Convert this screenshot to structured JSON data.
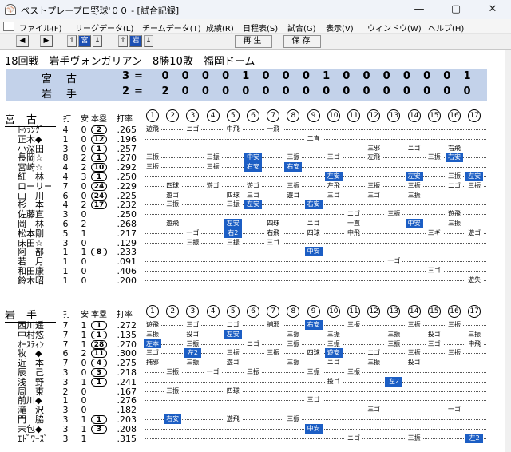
{
  "window": {
    "title": "ベストプレープロ野球'００ - [試合記録]",
    "app_icon": "baseball-icon"
  },
  "menu": [
    "ファイル(F)",
    "リーグデータ(L)",
    "チームデータ(T)",
    "成績(R)",
    "日程表(S)",
    "試合(G)",
    "表示(V)",
    "ウィンドウ(W)",
    "ヘルプ(H)"
  ],
  "toolbar": {
    "prev": "◀",
    "next": "▶",
    "up1": "↑",
    "team1": "宮",
    "down1": "↓",
    "up2": "↑",
    "team2": "岩",
    "down2": "↓",
    "play": "再生",
    "save": "保存"
  },
  "game_info": "18回戦　岩手ヴォンガリアン　8勝10敗　福岡ドーム",
  "scoreboard": {
    "rows": [
      {
        "team": "宮古",
        "total": "3",
        "eq": "=",
        "innings": [
          "0",
          "0",
          "0",
          "0",
          "1",
          "0",
          "0",
          "0",
          "1",
          "0",
          "0",
          "0",
          "0",
          "0",
          "0",
          "1"
        ]
      },
      {
        "team": "岩手",
        "total": "2",
        "eq": "=",
        "innings": [
          "2",
          "0",
          "0",
          "0",
          "0",
          "0",
          "0",
          "0",
          "0",
          "0",
          "0",
          "0",
          "0",
          "0",
          "0",
          "0"
        ]
      }
    ]
  },
  "columns": {
    "ab": "打",
    "hits": "安",
    "hr": "本塁",
    "avg": "打率"
  },
  "inning_numbers": [
    "1",
    "2",
    "3",
    "4",
    "5",
    "6",
    "7",
    "8",
    "9",
    "10",
    "11",
    "12",
    "13",
    "14",
    "15",
    "16",
    "17"
  ],
  "teams": [
    {
      "name": "宮古",
      "players": [
        {
          "name": "ﾄｩﾗﾝｸﾞ",
          "ab": "4",
          "h": "0",
          "hr": "2",
          "avg": ".265",
          "r": [
            "遊飛",
            "",
            "ニゴ",
            "",
            "中飛",
            "",
            "一飛",
            "",
            "",
            "",
            "",
            "",
            "",
            "",
            "",
            "",
            ""
          ]
        },
        {
          "name": "正木◆",
          "ab": "1",
          "h": "0",
          "hr": "12",
          "avg": ".196",
          "r": [
            "",
            "",
            "",
            "",
            "",
            "",
            "",
            "",
            "二直",
            "",
            "",
            "",
            "",
            "",
            "",
            "",
            ""
          ]
        },
        {
          "name": "小深田",
          "ab": "3",
          "h": "0",
          "hr": "1",
          "avg": ".257",
          "r": [
            "",
            "",
            "",
            "",
            "",
            "",
            "",
            "",
            "",
            "",
            "",
            "三邪",
            "",
            "ニゴ",
            "",
            "右飛",
            ""
          ]
        },
        {
          "name": "長岡☆",
          "ab": "8",
          "h": "2",
          "hr": "1",
          "avg": ".270",
          "r": [
            "三振",
            "",
            "",
            "三振",
            "",
            "中安",
            "",
            "三振",
            "",
            "三ゴ",
            "",
            "左飛",
            "",
            "",
            "三振",
            "右安",
            ""
          ]
        },
        {
          "name": "宮崎☆",
          "ab": "4",
          "h": "2",
          "hr": "10",
          "avg": ".292",
          "r": [
            "三振",
            "",
            "",
            "三振",
            "",
            "右安",
            "",
            "右安",
            "",
            "",
            "",
            "",
            "",
            "",
            "",
            "",
            ""
          ]
        },
        {
          "name": "紅　林",
          "ab": "4",
          "h": "3",
          "hr": "1",
          "avg": ".250",
          "r": [
            "",
            "",
            "",
            "",
            "",
            "",
            "",
            "",
            "",
            "左安",
            "",
            "",
            "",
            "左安",
            "",
            "三振",
            "左安"
          ]
        },
        {
          "name": "ローリー",
          "ab": "7",
          "h": "0",
          "hr": "24",
          "avg": ".229",
          "r": [
            "",
            "四球",
            "",
            "遊ゴ",
            "",
            "遊ゴ",
            "",
            "三振",
            "",
            "左飛",
            "",
            "三振",
            "",
            "三振",
            "",
            "ニゴ",
            "三振"
          ]
        },
        {
          "name": "山　川",
          "ab": "6",
          "h": "0",
          "hr": "24",
          "avg": ".225",
          "r": [
            "",
            "遊ゴ",
            "",
            "",
            "四球",
            "三ゴ",
            "",
            "遊ゴ",
            "",
            "三ゴ",
            "",
            "三ゴ",
            "",
            "三振",
            "",
            "",
            ""
          ]
        },
        {
          "name": "杉　本",
          "ab": "4",
          "h": "2",
          "hr": "17",
          "avg": ".232",
          "r": [
            "",
            "三振",
            "",
            "",
            "三振",
            "左安",
            "",
            "",
            "右安",
            "",
            "",
            "",
            "",
            "",
            "",
            "",
            ""
          ]
        },
        {
          "name": "佐藤直",
          "ab": "3",
          "h": "0",
          "hr": "",
          "avg": ".250",
          "r": [
            "",
            "",
            "",
            "",
            "",
            "",
            "",
            "",
            "",
            "",
            "ニゴ",
            "",
            "三振",
            "",
            "",
            "遊飛",
            ""
          ]
        },
        {
          "name": "岡　林",
          "ab": "6",
          "h": "2",
          "hr": "",
          "avg": ".268",
          "r": [
            "",
            "遊飛",
            "",
            "",
            "左安",
            "",
            "四球",
            "",
            "ニゴ",
            "",
            "一直",
            "",
            "",
            "中安",
            "",
            "三振",
            ""
          ]
        },
        {
          "name": "松本剛",
          "ab": "5",
          "h": "1",
          "hr": "",
          "avg": ".217",
          "r": [
            "",
            "",
            "一ゴ",
            "",
            "右2",
            "",
            "右飛",
            "",
            "四球",
            "",
            "中飛",
            "",
            "",
            "",
            "三ギ",
            "",
            "遊ゴ"
          ]
        },
        {
          "name": "床田☆",
          "ab": "3",
          "h": "0",
          "hr": "",
          "avg": ".129",
          "r": [
            "",
            "",
            "三振",
            "",
            "三振",
            "",
            "三ゴ",
            "",
            "",
            "",
            "",
            "",
            "",
            "",
            "",
            "",
            ""
          ]
        },
        {
          "name": "阿　部",
          "ab": "1",
          "h": "1",
          "hr": "8",
          "avg": ".233",
          "r": [
            "",
            "",
            "",
            "",
            "",
            "",
            "",
            "",
            "中安",
            "",
            "",
            "",
            "",
            "",
            "",
            "",
            ""
          ]
        },
        {
          "name": "若　月",
          "ab": "1",
          "h": "0",
          "hr": "",
          "avg": ".091",
          "r": [
            "",
            "",
            "",
            "",
            "",
            "",
            "",
            "",
            "",
            "",
            "",
            "",
            "一ゴ",
            "",
            "",
            "",
            ""
          ]
        },
        {
          "name": "和田康",
          "ab": "1",
          "h": "0",
          "hr": "",
          "avg": ".406",
          "r": [
            "",
            "",
            "",
            "",
            "",
            "",
            "",
            "",
            "",
            "",
            "",
            "",
            "",
            "",
            "三ゴ",
            "",
            ""
          ]
        },
        {
          "name": "鈴木昭",
          "ab": "1",
          "h": "0",
          "hr": "",
          "avg": ".200",
          "r": [
            "",
            "",
            "",
            "",
            "",
            "",
            "",
            "",
            "",
            "",
            "",
            "",
            "",
            "",
            "",
            "",
            "遊失"
          ]
        }
      ]
    },
    {
      "name": "岩手",
      "players": [
        {
          "name": "西川遥",
          "ab": "7",
          "h": "1",
          "hr": "1",
          "avg": ".272",
          "r": [
            "遊飛",
            "",
            "三ゴ",
            "",
            "ニゴ",
            "",
            "捕邪",
            "",
            "右安",
            "",
            "三振",
            "",
            "",
            "三振",
            "",
            "三振",
            ""
          ]
        },
        {
          "name": "中村悠",
          "ab": "7",
          "h": "1",
          "hr": "1",
          "avg": ".135",
          "r": [
            "三振",
            "",
            "投ゴ",
            "",
            "左安",
            "",
            "",
            "三振",
            "",
            "三振",
            "",
            "",
            "三振",
            "",
            "投ゴ",
            "",
            "三振"
          ]
        },
        {
          "name": "ｵｰｽﾃｨﾝ",
          "ab": "7",
          "h": "1",
          "hr": "28",
          "avg": ".270",
          "r": [
            "左本",
            "",
            "三振",
            "",
            "",
            "ニゴ",
            "",
            "三振",
            "",
            "三振",
            "",
            "",
            "三振",
            "",
            "三ゴ",
            "",
            "中飛"
          ]
        },
        {
          "name": "牧　◆",
          "ab": "6",
          "h": "2",
          "hr": "11",
          "avg": ".300",
          "r": [
            "三ゴ",
            "",
            "左2",
            "",
            "三振",
            "",
            "三振",
            "",
            "四球",
            "遊安",
            "",
            "ニゴ",
            "",
            "三振",
            "",
            "三振",
            ""
          ]
        },
        {
          "name": "近　本",
          "ab": "7",
          "h": "0",
          "hr": "4",
          "avg": ".275",
          "r": [
            "捕邪",
            "",
            "三振",
            "",
            "遊ゴ",
            "",
            "",
            "三振",
            "",
            "ニゴ",
            "",
            "三振",
            "",
            "投ゴ",
            "",
            "",
            ""
          ]
        },
        {
          "name": "辰　己",
          "ab": "3",
          "h": "0",
          "hr": "3",
          "avg": ".218",
          "r": [
            "",
            "三振",
            "",
            "一ゴ",
            "",
            "三振",
            "",
            "",
            "三振",
            "",
            "三振",
            "",
            "",
            "",
            "",
            "",
            ""
          ]
        },
        {
          "name": "浅　野",
          "ab": "3",
          "h": "1",
          "hr": "1",
          "avg": ".241",
          "r": [
            "",
            "",
            "",
            "",
            "",
            "",
            "",
            "",
            "",
            "投ゴ",
            "",
            "",
            "左2",
            "",
            "",
            "",
            ""
          ]
        },
        {
          "name": "周　東",
          "ab": "2",
          "h": "0",
          "hr": "",
          "avg": ".167",
          "r": [
            "",
            "三振",
            "",
            "",
            "四球",
            "",
            "",
            "",
            "",
            "",
            "",
            "",
            "",
            "",
            "",
            "",
            ""
          ]
        },
        {
          "name": "前川◆",
          "ab": "1",
          "h": "0",
          "hr": "",
          "avg": ".276",
          "r": [
            "",
            "",
            "",
            "",
            "",
            "",
            "",
            "",
            "三ゴ",
            "",
            "",
            "",
            "",
            "",
            "",
            "",
            ""
          ]
        },
        {
          "name": "滝　沢",
          "ab": "3",
          "h": "0",
          "hr": "",
          "avg": ".182",
          "r": [
            "",
            "",
            "",
            "",
            "",
            "",
            "",
            "",
            "",
            "",
            "",
            "三ゴ",
            "",
            "",
            "",
            "一ゴ",
            ""
          ]
        },
        {
          "name": "門　脇",
          "ab": "3",
          "h": "1",
          "hr": "1",
          "avg": ".203",
          "r": [
            "",
            "右安",
            "",
            "",
            "遊飛",
            "",
            "",
            "三振",
            "",
            "",
            "",
            "",
            "",
            "",
            "",
            "",
            ""
          ]
        },
        {
          "name": "末包◆",
          "ab": "3",
          "h": "1",
          "hr": "3",
          "avg": ".208",
          "r": [
            "",
            "",
            "",
            "",
            "",
            "",
            "",
            "",
            "中安",
            "",
            "",
            "",
            "",
            "",
            "",
            "",
            ""
          ]
        },
        {
          "name": "ｴﾄﾞﾜｰｽﾞ",
          "ab": "3",
          "h": "1",
          "hr": "",
          "avg": ".315",
          "r": [
            "",
            "",
            "",
            "",
            "",
            "",
            "",
            "",
            "",
            "",
            "ニゴ",
            "",
            "",
            "三振",
            "",
            "",
            "左2"
          ]
        }
      ]
    }
  ]
}
